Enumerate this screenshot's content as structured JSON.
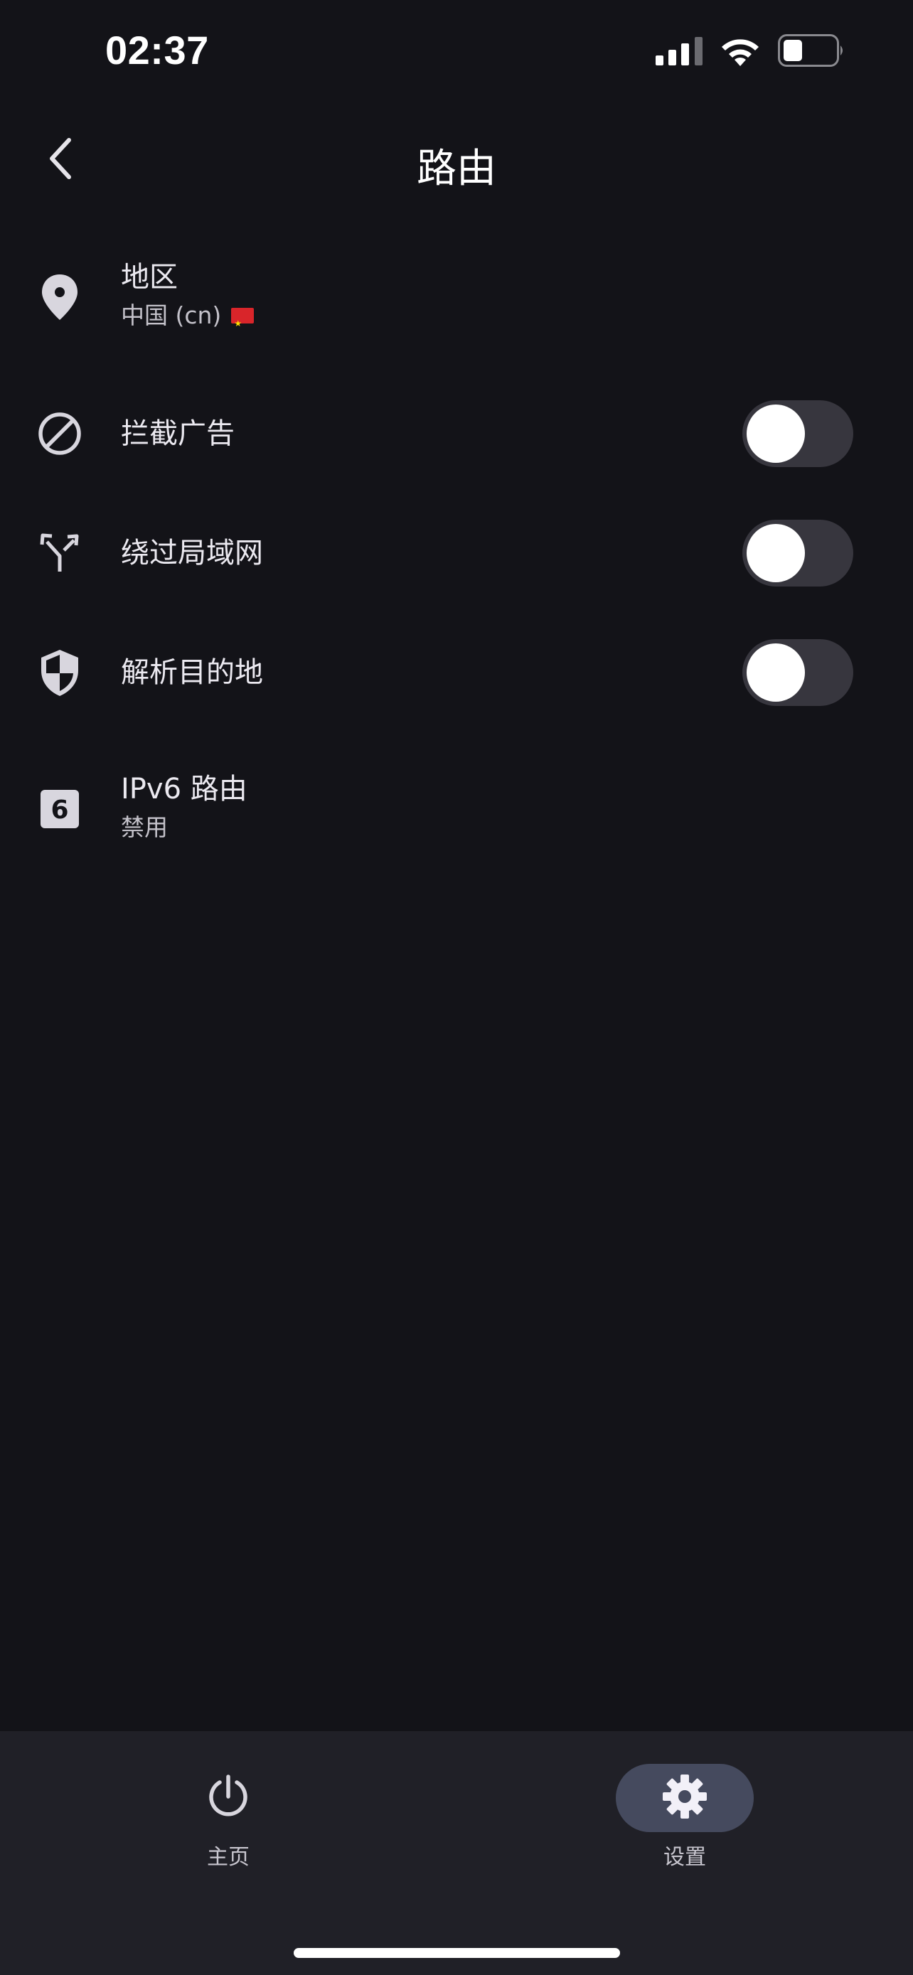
{
  "status_bar": {
    "time": "02:37",
    "signal_icon": "cellular-signal-icon",
    "wifi_icon": "wifi-icon",
    "battery_icon": "battery-icon",
    "battery_level": 0.3
  },
  "header": {
    "title": "路由",
    "back_icon": "chevron-left-icon"
  },
  "settings": {
    "region": {
      "icon": "location-pin-icon",
      "title": "地区",
      "value": "中国 (cn)",
      "flag": "china-flag-icon"
    },
    "block_ads": {
      "icon": "block-icon",
      "title": "拦截广告",
      "enabled": false
    },
    "bypass_lan": {
      "icon": "fork-arrows-icon",
      "title": "绕过局域网",
      "enabled": false
    },
    "resolve_destination": {
      "icon": "shield-icon",
      "title": "解析目的地",
      "enabled": false
    },
    "ipv6_route": {
      "icon": "number-6-box-icon",
      "title": "IPv6 路由",
      "value": "禁用"
    }
  },
  "bottom_nav": {
    "items": [
      {
        "label": "主页",
        "icon": "power-icon",
        "active": false
      },
      {
        "label": "设置",
        "icon": "gear-icon",
        "active": true
      }
    ]
  },
  "colors": {
    "background": "#131318",
    "nav_background": "#202027",
    "active_pill": "#454a5e",
    "toggle_track": "#37363e"
  }
}
